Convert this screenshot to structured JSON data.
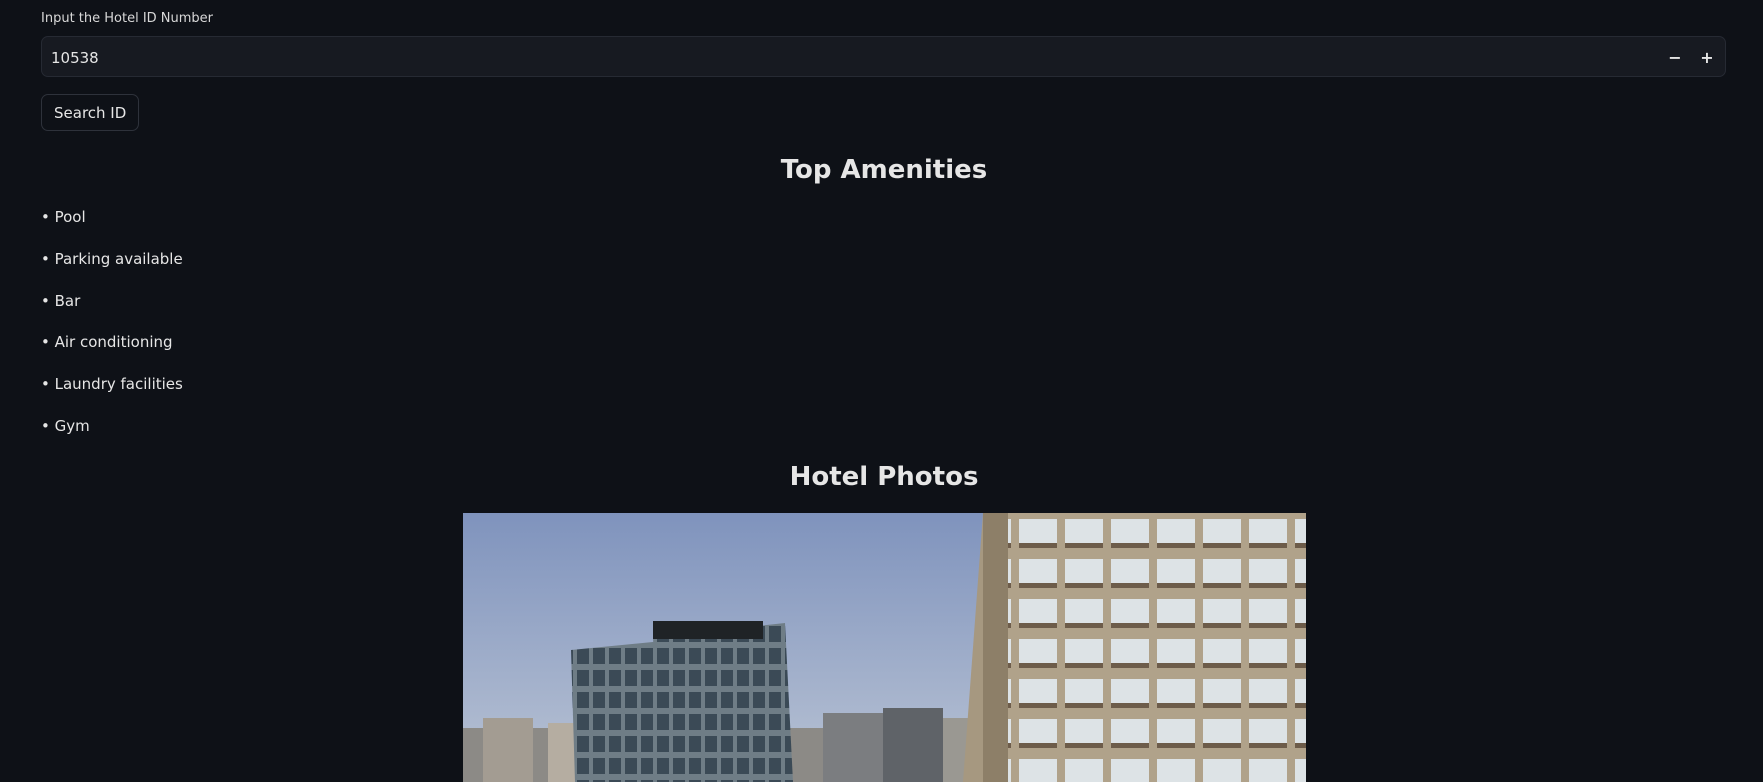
{
  "hotel_id_input": {
    "label": "Input the Hotel ID Number",
    "value": "10538",
    "decrement_symbol": "−",
    "increment_symbol": "+"
  },
  "search_button": {
    "label": "Search ID"
  },
  "amenities": {
    "title": "Top Amenities",
    "items": [
      "• Pool",
      "• Parking available",
      "• Bar",
      "• Air conditioning",
      "• Laundry facilities",
      "• Gym"
    ]
  },
  "photos": {
    "title": "Hotel Photos"
  },
  "colors": {
    "background": "#0e1117",
    "input_background": "#171a21",
    "text": "#e6e6e6"
  }
}
